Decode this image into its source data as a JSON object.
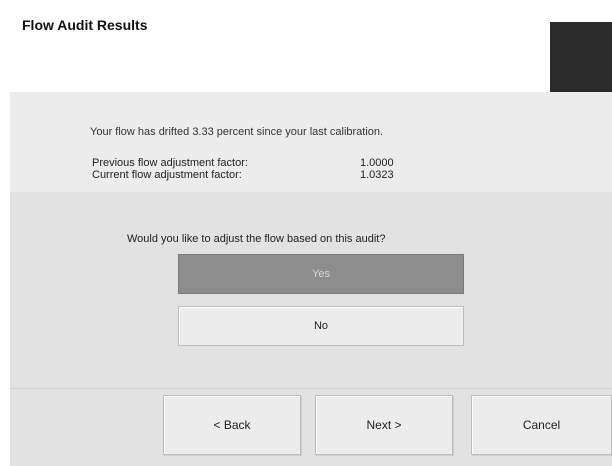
{
  "header": {
    "title": "Flow Audit Results"
  },
  "info": {
    "drift_message": "Your flow has drifted 3.33 percent since your last calibration.",
    "previous_label": "Previous flow adjustment factor:",
    "previous_value": "1.0000",
    "current_label": "Current flow adjustment factor:",
    "current_value": "1.0323"
  },
  "prompt": {
    "question": "Would you like to adjust the flow based on this audit?",
    "yes_label": "Yes",
    "no_label": "No"
  },
  "nav": {
    "back_label": "< Back",
    "next_label": "Next >",
    "cancel_label": "Cancel"
  }
}
